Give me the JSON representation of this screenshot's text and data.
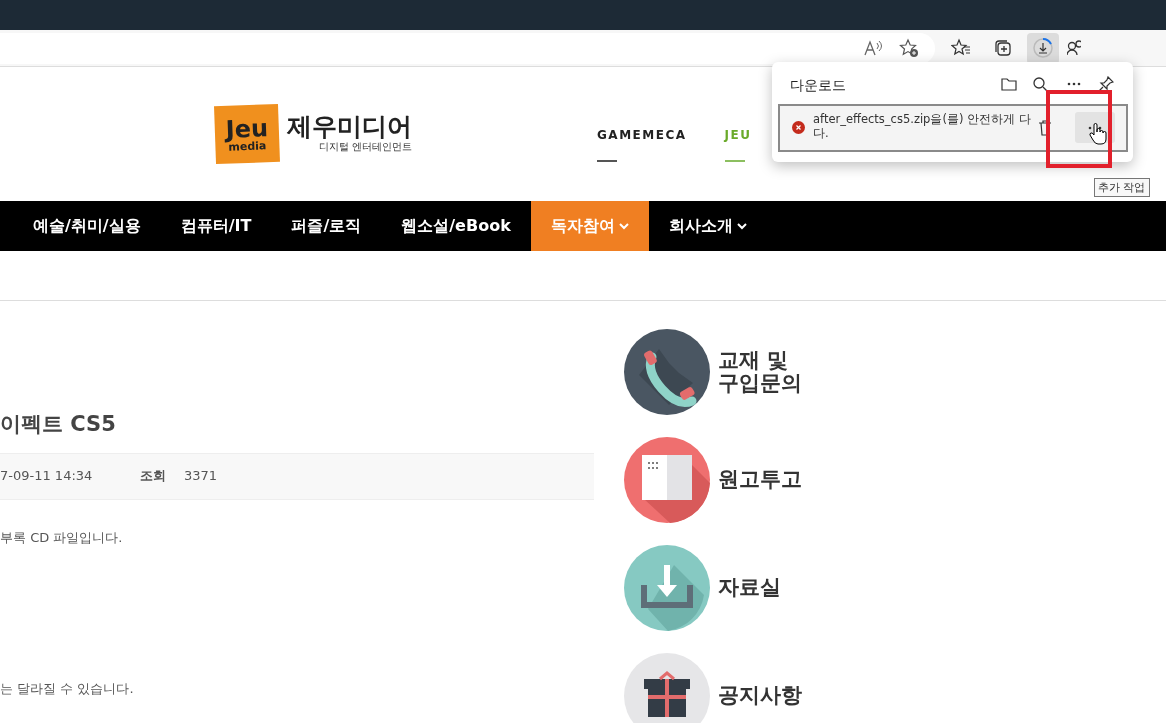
{
  "browser": {
    "downloads_open": true
  },
  "logo": {
    "badge_top": "Jeu",
    "badge_bottom": "media",
    "name": "제우미디어",
    "tagline": "디지털 엔터테인먼트"
  },
  "partner_links": [
    {
      "label": "GAMEMECA",
      "color": "#222222"
    },
    {
      "label": "JEU",
      "color": "#6aaa2a"
    }
  ],
  "nav": [
    {
      "label": "예술/취미/실용",
      "selected": false,
      "dropdown": false
    },
    {
      "label": "컴퓨터/IT",
      "selected": false,
      "dropdown": false
    },
    {
      "label": "퍼즐/로직",
      "selected": false,
      "dropdown": false
    },
    {
      "label": "웹소설/eBook",
      "selected": false,
      "dropdown": false
    },
    {
      "label": "독자참여",
      "selected": true,
      "dropdown": true
    },
    {
      "label": "회사소개",
      "selected": false,
      "dropdown": true
    }
  ],
  "post": {
    "title": "이펙트 CS5",
    "date": "7-09-11 14:34",
    "views_label": "조회",
    "views": "3371",
    "paragraphs": [
      "부록 CD 파일입니다.",
      "는 달라질 수 있습니다."
    ]
  },
  "quick_links": [
    {
      "kind": "phone",
      "lines": [
        "교재 및",
        "구입문의"
      ]
    },
    {
      "kind": "manuscript",
      "lines": [
        "원고투고"
      ]
    },
    {
      "kind": "download",
      "lines": [
        "자료실"
      ]
    },
    {
      "kind": "notice",
      "lines": [
        "공지사항"
      ]
    }
  ],
  "download_panel": {
    "title": "다운로드",
    "items": [
      {
        "failed": true,
        "lines": [
          "after_effects_cs5.zip을(를) 안전하게 다",
          "다."
        ],
        "more_hovered": true
      }
    ],
    "tooltip": "추가 작업"
  }
}
